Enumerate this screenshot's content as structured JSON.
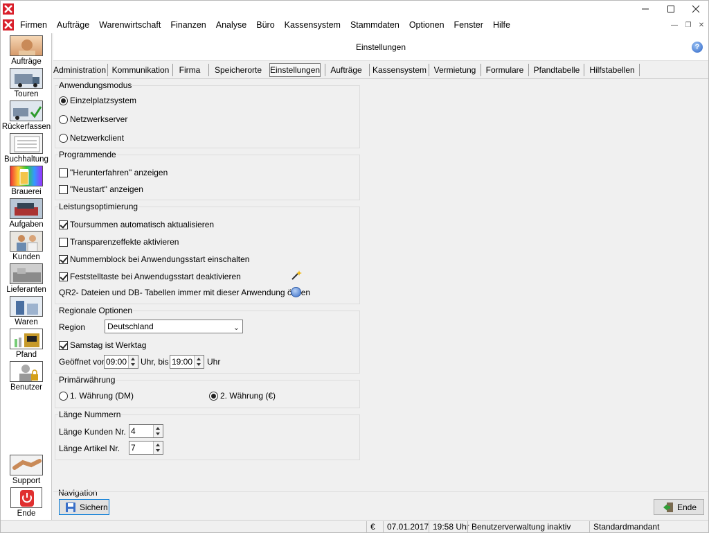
{
  "window": {
    "title": ""
  },
  "menu": {
    "items": [
      "Firmen",
      "Aufträge",
      "Warenwirtschaft",
      "Finanzen",
      "Analyse",
      "Büro",
      "Kassensystem",
      "Stammdaten",
      "Optionen",
      "Fenster",
      "Hilfe"
    ]
  },
  "sidebar": {
    "items": [
      {
        "label": "Aufträge",
        "icon": "order-person-icon"
      },
      {
        "label": "Touren",
        "icon": "truck-icon"
      },
      {
        "label": "Rückerfassen",
        "icon": "truck-check-icon"
      },
      {
        "label": "Buchhaltung",
        "icon": "ledger-icon"
      },
      {
        "label": "Brauerei",
        "icon": "brewery-icon"
      },
      {
        "label": "Aufgaben",
        "icon": "tasks-icon"
      },
      {
        "label": "Kunden",
        "icon": "customers-icon"
      },
      {
        "label": "Lieferanten",
        "icon": "suppliers-icon"
      },
      {
        "label": "Waren",
        "icon": "goods-icon"
      },
      {
        "label": "Pfand",
        "icon": "deposit-crate-icon"
      },
      {
        "label": "Benutzer",
        "icon": "user-lock-icon"
      }
    ],
    "bottom": [
      {
        "label": "Support",
        "icon": "handshake-icon"
      },
      {
        "label": "Ende",
        "icon": "power-icon"
      }
    ]
  },
  "content": {
    "title": "Einstellungen",
    "help_icon": "help-icon"
  },
  "tabs": [
    "Administration",
    "Kommunikation",
    "Firma",
    "Speicherorte",
    "Einstellungen",
    "Aufträge",
    "Kassensystem",
    "Vermietung",
    "Formulare",
    "Pfandtabelle",
    "Hilfstabellen"
  ],
  "active_tab": "Einstellungen",
  "anwendungsmodus": {
    "title": "Anwendungsmodus",
    "options": [
      {
        "label": "Einzelplatzsystem",
        "selected": true
      },
      {
        "label": "Netzwerkserver",
        "selected": false
      },
      {
        "label": "Netzwerkclient",
        "selected": false
      }
    ]
  },
  "programmende": {
    "title": "Programmende",
    "options": [
      {
        "label": "\"Herunterfahren\" anzeigen",
        "checked": false
      },
      {
        "label": "\"Neustart\" anzeigen",
        "checked": false
      }
    ]
  },
  "leistung": {
    "title": "Leistungsoptimierung",
    "options": [
      {
        "label": "Toursummen automatisch aktualisieren",
        "checked": true
      },
      {
        "label": "Transparenzeffekte aktivieren",
        "checked": false
      },
      {
        "label": "Nummernblock bei Anwendungsstart einschalten",
        "checked": true
      },
      {
        "label": "Feststelltaste bei Anwendugsstart deaktivieren",
        "checked": true
      }
    ],
    "qr2_label": "QR2- Dateien und DB- Tabellen immer mit dieser Anwendung öffnen"
  },
  "regional": {
    "title": "Regionale Optionen",
    "region_label": "Region",
    "region_value": "Deutschland",
    "samstag_label": "Samstag ist Werktag",
    "samstag_checked": true,
    "open_label": "Geöffnet von",
    "open_from": "09:00",
    "uhr_bis": "Uhr, bis",
    "open_to": "19:00",
    "uhr": "Uhr"
  },
  "waehrung": {
    "title": "Primärwährung",
    "options": [
      {
        "label": "1. Währung (DM)",
        "selected": false
      },
      {
        "label": "2. Währung (€)",
        "selected": true
      }
    ]
  },
  "laenge": {
    "title": "Länge Nummern",
    "kunden_label": "Länge Kunden Nr.",
    "kunden_value": "4",
    "artikel_label": "Länge Artikel Nr.",
    "artikel_value": "7"
  },
  "navigation": {
    "title": "Navigation",
    "save_label": "Sichern",
    "end_label": "Ende"
  },
  "status": {
    "currency": "€",
    "date": "07.01.2017",
    "time": "19:58 Uhr",
    "user_admin": "Benutzerverwaltung inaktiv",
    "mandant": "Standardmandant"
  }
}
